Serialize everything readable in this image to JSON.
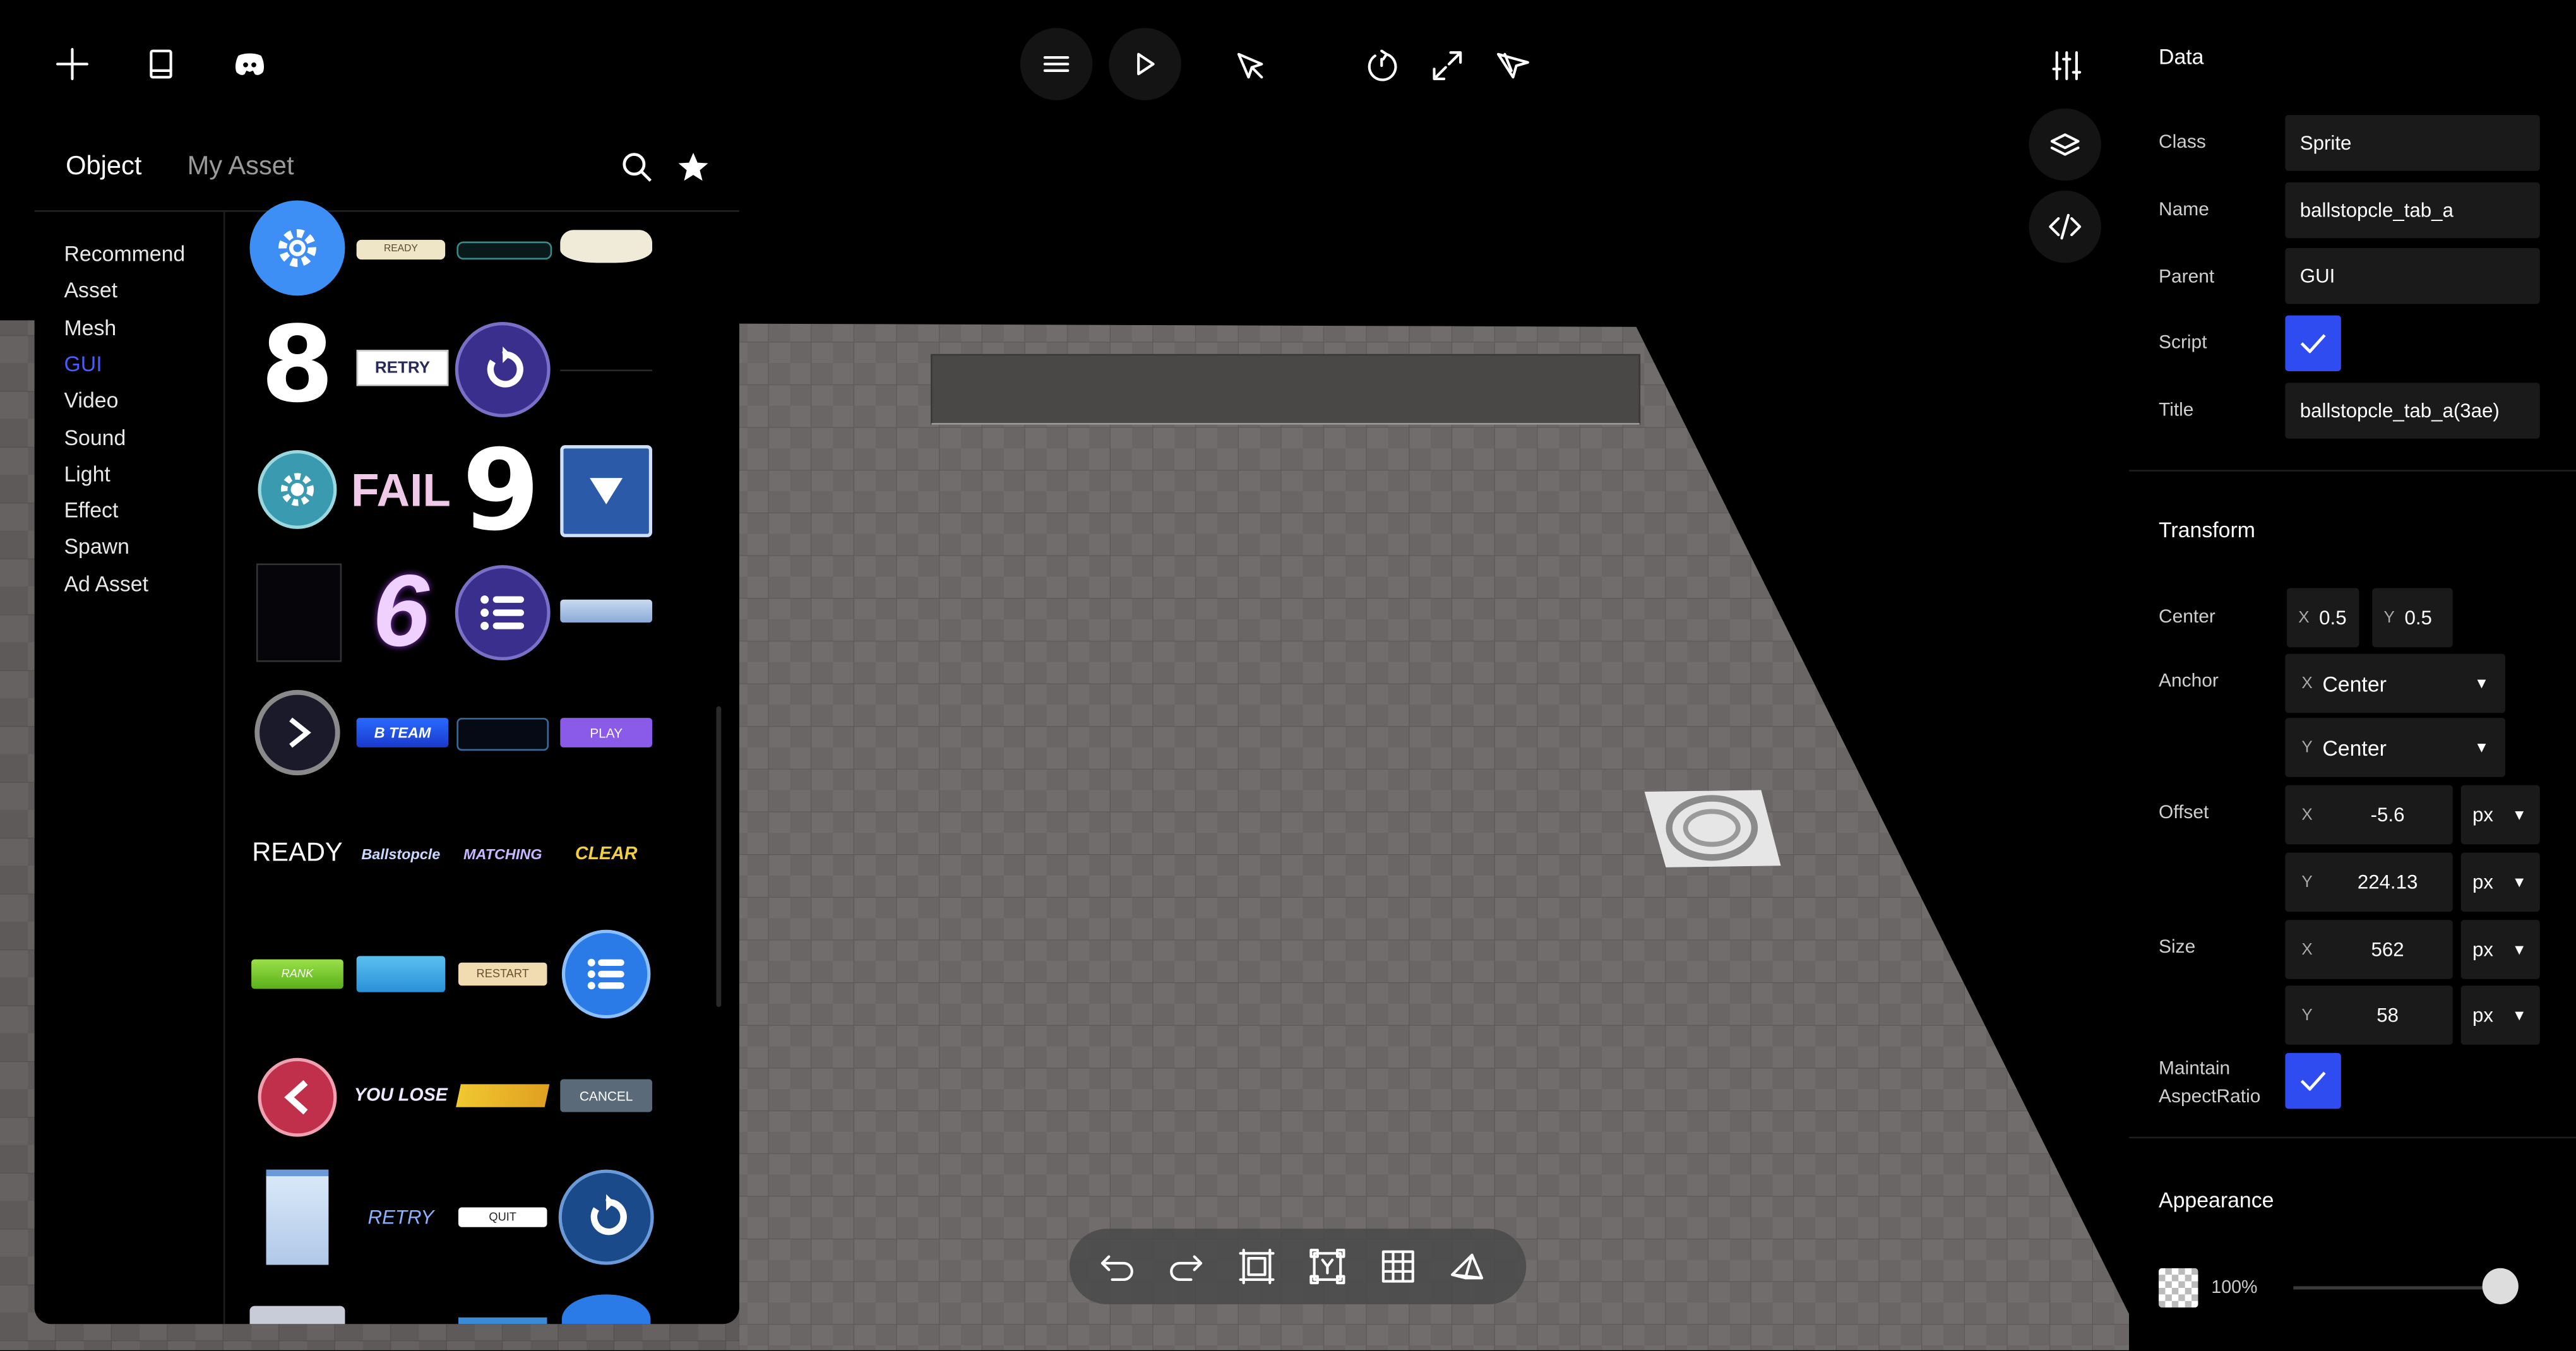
{
  "top_toolbar": {
    "left": [
      "add-icon",
      "book-icon",
      "discord-icon"
    ],
    "center": [
      "menu-icon",
      "play-icon",
      "select-cursor-icon",
      "rotate-icon",
      "expand-icon",
      "move-cursor-icon"
    ],
    "right": [
      "sliders-icon",
      "layers-icon",
      "code-icon"
    ]
  },
  "left_panel": {
    "tabs": [
      "Object",
      "My Asset"
    ],
    "active_tab": "Object",
    "categories": [
      "Recommend",
      "Asset",
      "Mesh",
      "GUI",
      "Video",
      "Sound",
      "Light",
      "Effect",
      "Spawn",
      "Ad Asset"
    ],
    "active_category": "GUI",
    "gui_items": {
      "ready_small": "READY",
      "number_8": "8",
      "retry_box": "RETRY",
      "fail": "FAIL",
      "number_9": "9",
      "number_6": "6",
      "b_team": "B TEAM",
      "play": "PLAY",
      "ready_big": "READY",
      "ballstopcle": "Ballstopcle",
      "matching": "MATCHING",
      "clear": "CLEAR",
      "rank": "RANK",
      "restart": "RESTART",
      "you_lose": "YOU LOSE",
      "cancel": "CANCEL",
      "retry_italic": "RETRY",
      "quit": "QUIT"
    }
  },
  "right_panel": {
    "data_title": "Data",
    "fields": {
      "class_label": "Class",
      "class_value": "Sprite",
      "name_label": "Name",
      "name_value": "ballstopcle_tab_a",
      "parent_label": "Parent",
      "parent_value": "GUI",
      "script_label": "Script",
      "title_label": "Title",
      "title_value": "ballstopcle_tab_a(3ae)"
    },
    "transform_title": "Transform",
    "transform": {
      "center_label": "Center",
      "center_x": "0.5",
      "center_y": "0.5",
      "anchor_label": "Anchor",
      "anchor_x": "Center",
      "anchor_y": "Center",
      "offset_label": "Offset",
      "offset_x": "-5.6",
      "offset_y": "224.13",
      "size_label": "Size",
      "size_x": "562",
      "size_y": "58",
      "unit": "px",
      "maintain_label_1": "Maintain",
      "maintain_label_2": "AspectRatio",
      "x": "X",
      "y": "Y"
    },
    "appearance_title": "Appearance",
    "opacity_text": "100%",
    "opacity_value": 1.0
  },
  "bottom_toolbar": [
    "undo-icon",
    "redo-icon",
    "frame-icon",
    "transform-icon",
    "grid-icon",
    "camera-icon"
  ]
}
